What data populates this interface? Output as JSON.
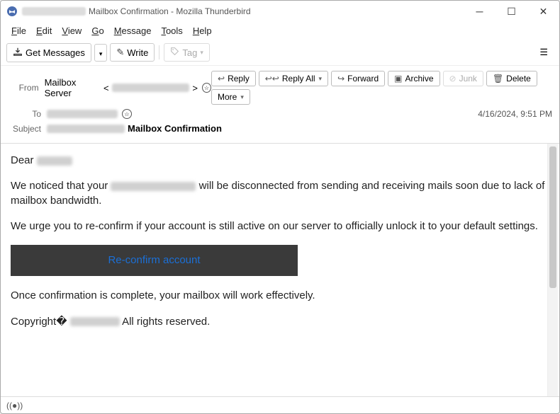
{
  "window": {
    "title_prefix_redacted": true,
    "title_suffix": "Mailbox Confirmation - Mozilla Thunderbird"
  },
  "menus": [
    "File",
    "Edit",
    "View",
    "Go",
    "Message",
    "Tools",
    "Help"
  ],
  "toolbar": {
    "get_messages": "Get Messages",
    "write": "Write",
    "tag": "Tag"
  },
  "headers": {
    "from_label": "From",
    "from_name": "Mailbox Server",
    "to_label": "To",
    "subject_label": "Subject",
    "subject_text": "Mailbox Confirmation",
    "date": "4/16/2024, 9:51 PM"
  },
  "actions": {
    "reply": "Reply",
    "reply_all": "Reply All",
    "forward": "Forward",
    "archive": "Archive",
    "junk": "Junk",
    "delete": "Delete",
    "more": "More"
  },
  "body": {
    "greet_prefix": "Dear",
    "p1_a": "We noticed that your",
    "p1_b": "will be disconnected from sending and receiving mails soon due to lack of mailbox bandwidth.",
    "p2": "We urge you to re-confirm if your account is still active on our server to officially unlock it to your default settings.",
    "cta": "Re-confirm account",
    "p3": "Once confirmation is complete, your mailbox will work effectively.",
    "copyright_a": "Copyright�",
    "copyright_b": "All rights reserved."
  }
}
